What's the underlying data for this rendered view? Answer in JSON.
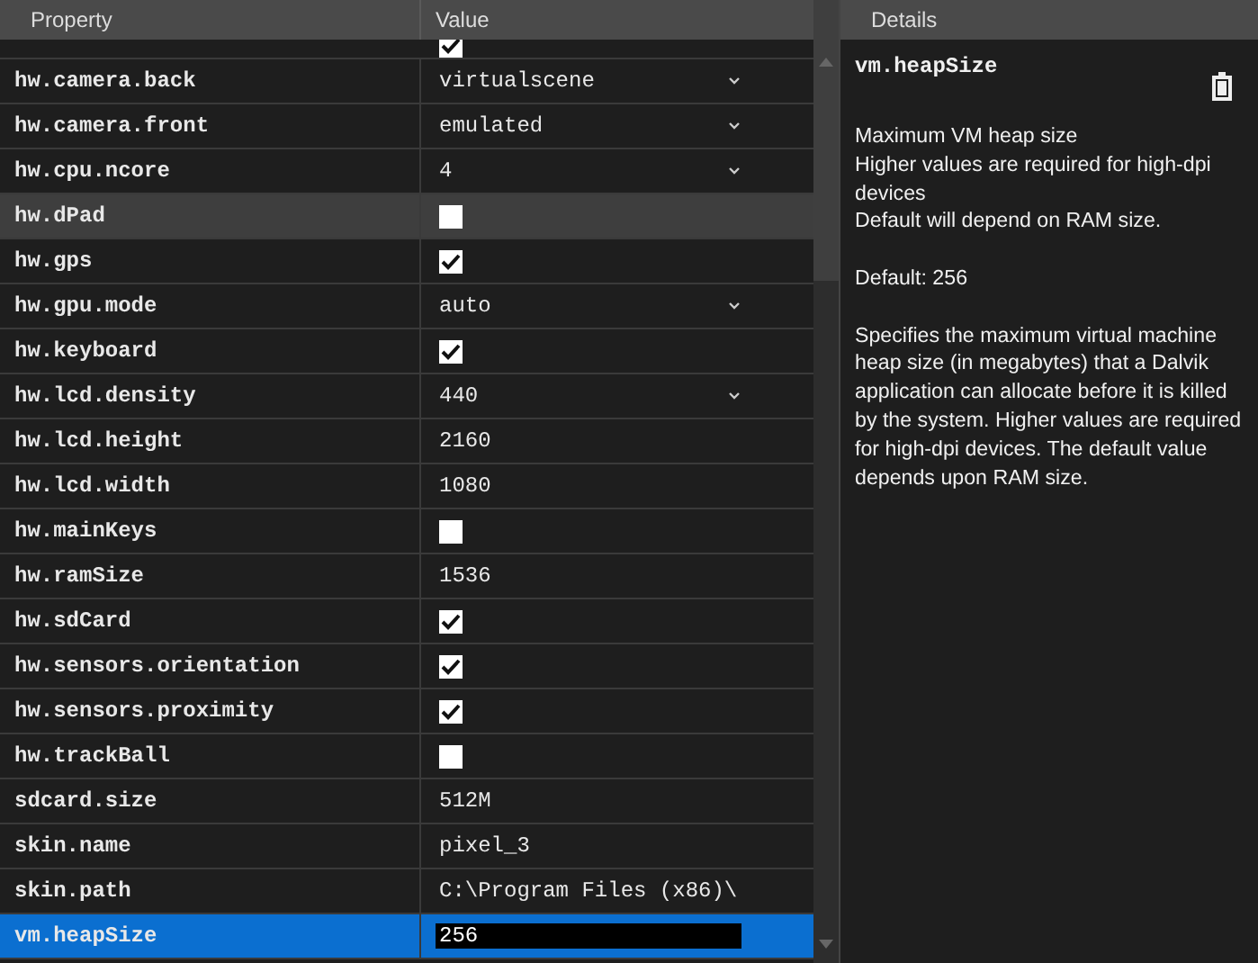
{
  "columns": [
    "Property",
    "Value"
  ],
  "details_header": "Details",
  "rows": [
    {
      "kind": "check",
      "checked": true,
      "partial": true
    },
    {
      "name": "hw.camera.back",
      "kind": "select",
      "value": "virtualscene"
    },
    {
      "name": "hw.camera.front",
      "kind": "select",
      "value": "emulated"
    },
    {
      "name": "hw.cpu.ncore",
      "kind": "select",
      "value": "4"
    },
    {
      "name": "hw.dPad",
      "kind": "check",
      "checked": false,
      "hovered": true
    },
    {
      "name": "hw.gps",
      "kind": "check",
      "checked": true
    },
    {
      "name": "hw.gpu.mode",
      "kind": "select",
      "value": "auto"
    },
    {
      "name": "hw.keyboard",
      "kind": "check",
      "checked": true
    },
    {
      "name": "hw.lcd.density",
      "kind": "select",
      "value": "440"
    },
    {
      "name": "hw.lcd.height",
      "kind": "text",
      "value": "2160"
    },
    {
      "name": "hw.lcd.width",
      "kind": "text",
      "value": "1080"
    },
    {
      "name": "hw.mainKeys",
      "kind": "check",
      "checked": false
    },
    {
      "name": "hw.ramSize",
      "kind": "text",
      "value": "1536"
    },
    {
      "name": "hw.sdCard",
      "kind": "check",
      "checked": true
    },
    {
      "name": "hw.sensors.orientation",
      "kind": "check",
      "checked": true
    },
    {
      "name": "hw.sensors.proximity",
      "kind": "check",
      "checked": true
    },
    {
      "name": "hw.trackBall",
      "kind": "check",
      "checked": false
    },
    {
      "name": "sdcard.size",
      "kind": "text",
      "value": "512M"
    },
    {
      "name": "skin.name",
      "kind": "text",
      "value": "pixel_3"
    },
    {
      "name": "skin.path",
      "kind": "text",
      "value": "C:\\Program Files (x86)\\"
    },
    {
      "name": "vm.heapSize",
      "kind": "edit",
      "value": "256",
      "selected": true
    }
  ],
  "details": {
    "title": "vm.heapSize",
    "paragraphs": [
      "Maximum VM heap size\nHigher values are required for high-dpi devices\nDefault will depend on RAM size.",
      "Default: 256",
      "Specifies the maximum virtual machine heap size (in megabytes) that a Dalvik application can allocate before it is killed by the system. Higher values are required for high-dpi devices. The default value depends upon RAM size."
    ]
  }
}
